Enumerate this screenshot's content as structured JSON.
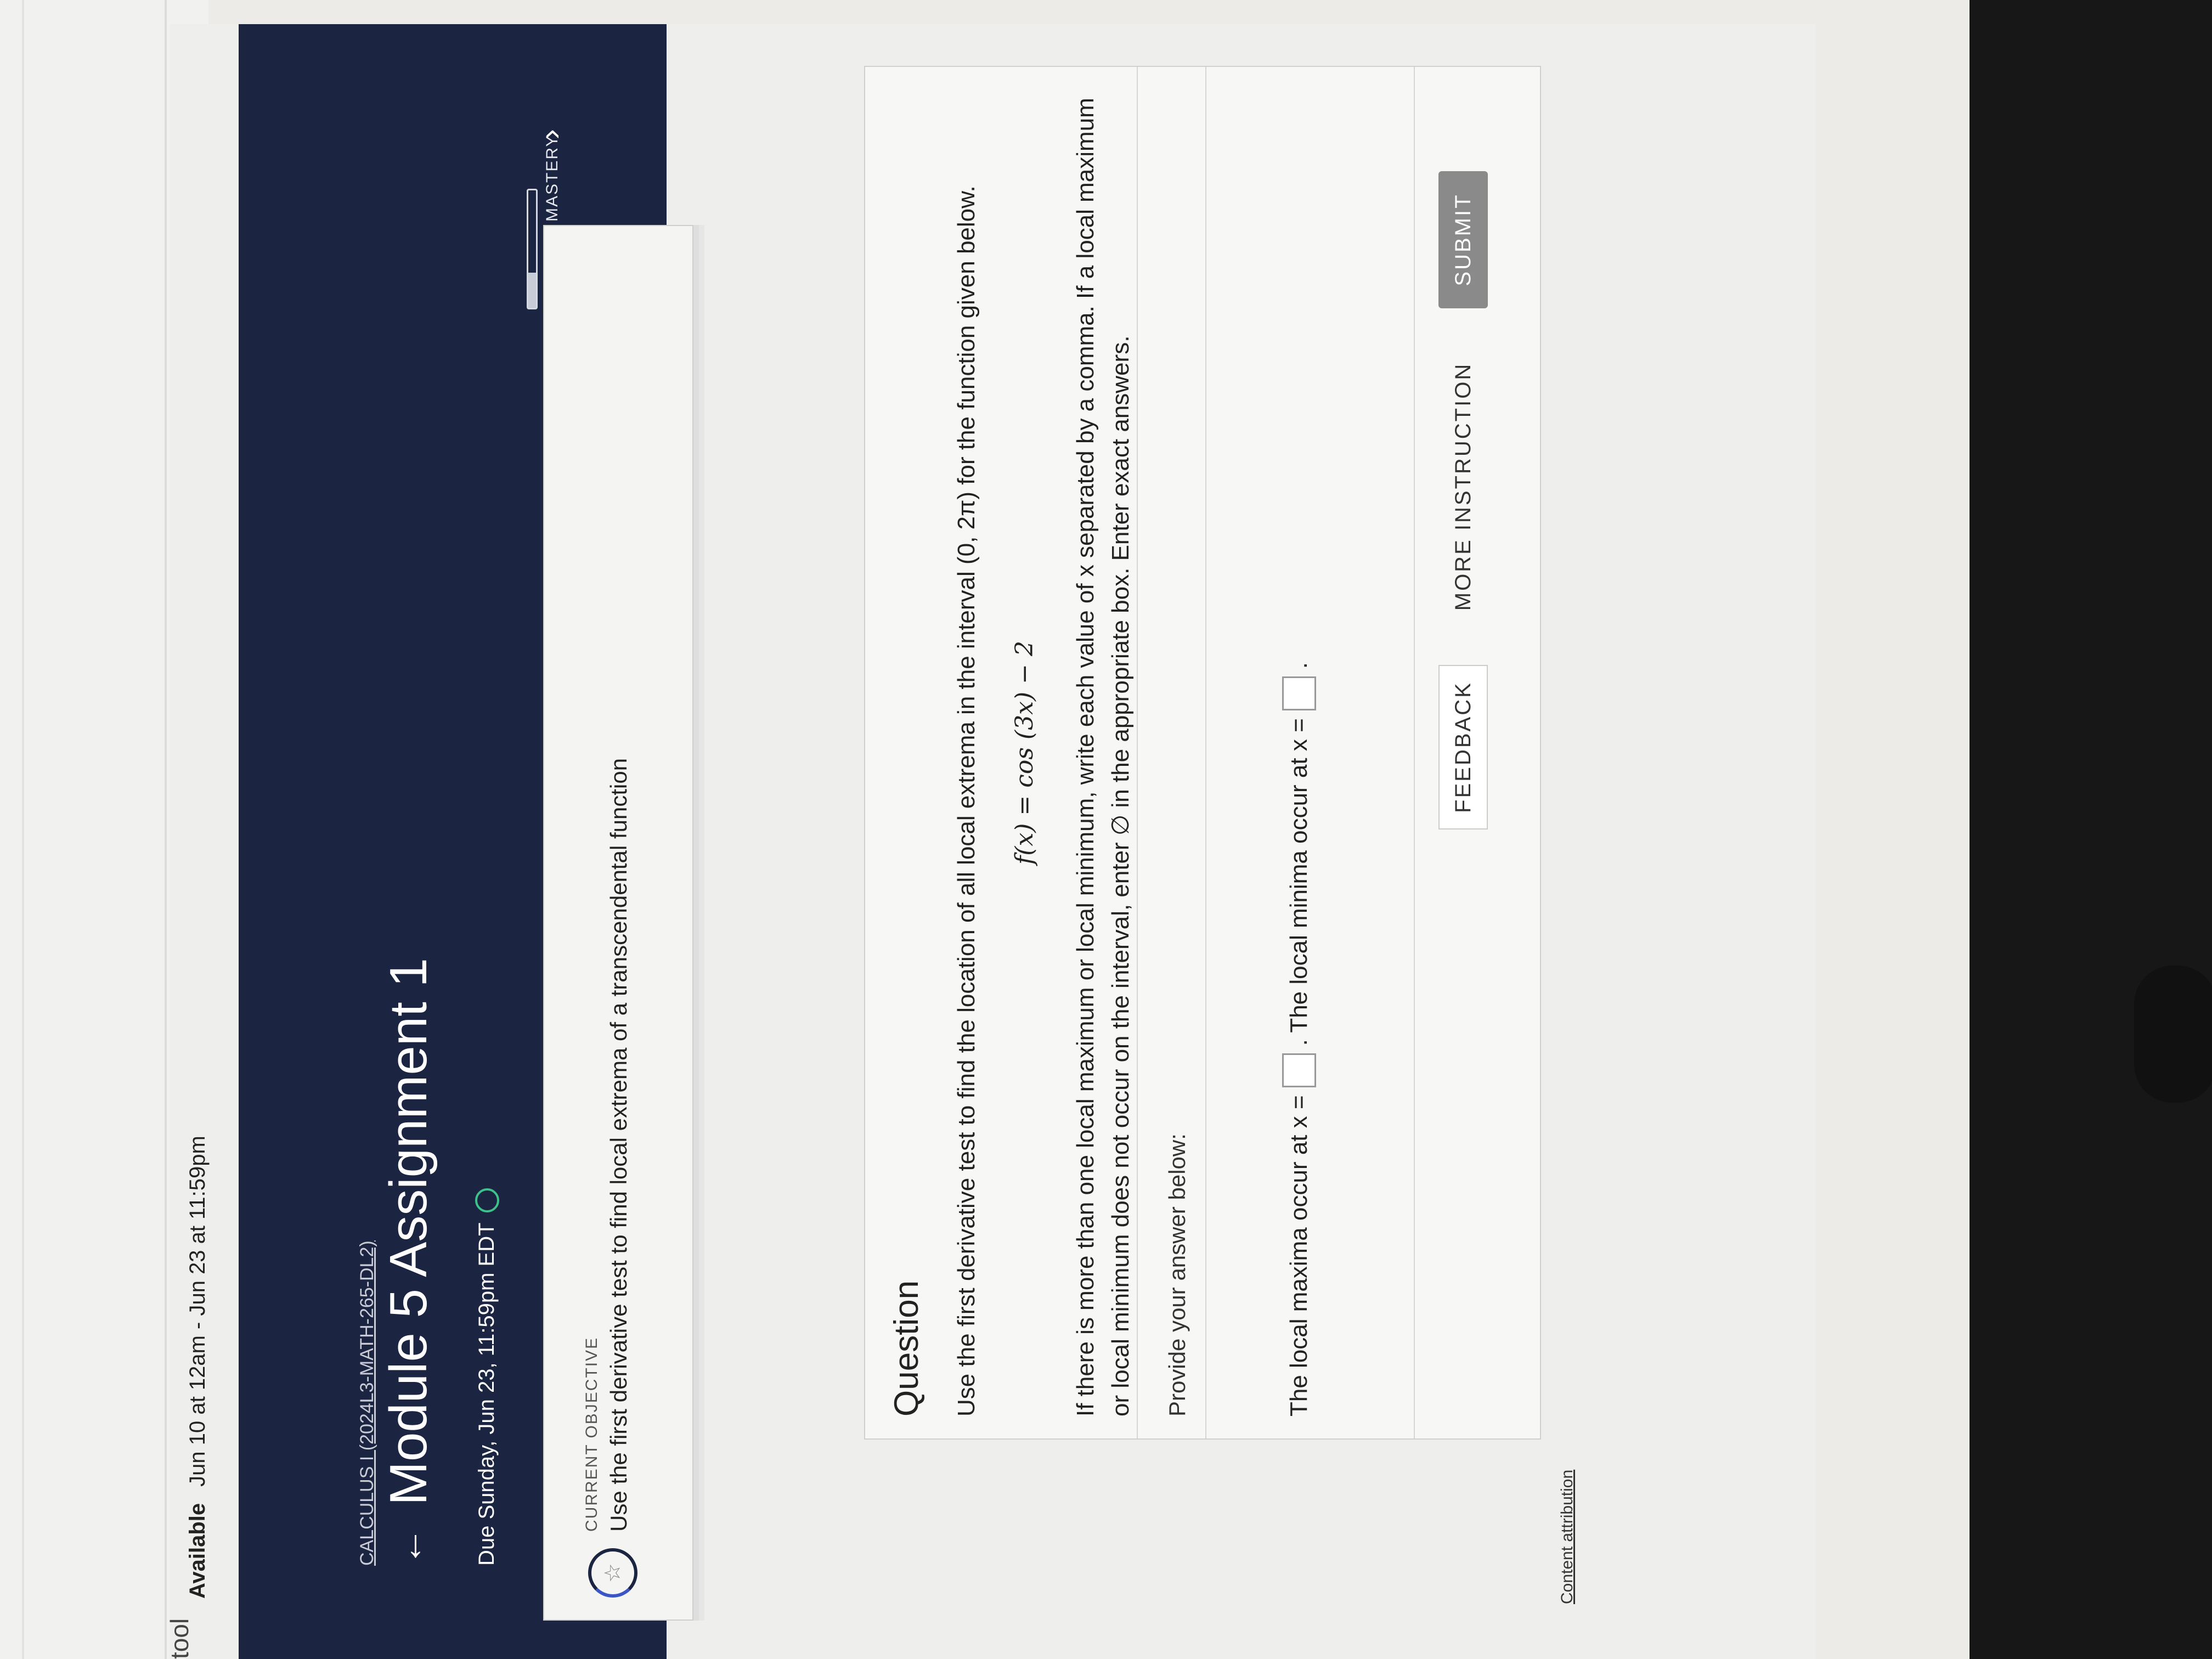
{
  "browser": {
    "tab_text": "tool"
  },
  "availability": {
    "label": "Available",
    "range": "Jun 10 at 12am - Jun 23 at 11:59pm"
  },
  "header": {
    "course": "CALCULUS I (2024L3-MATH-265-DL2)",
    "title": "Module 5 Assignment 1",
    "due": "Due Sunday, Jun 23, 11:59pm EDT",
    "mastery_label": "MASTERY",
    "mastery_progress": 0.3
  },
  "objective": {
    "caption": "CURRENT OBJECTIVE",
    "text": "Use the first derivative test to find local extrema of a transcendental function"
  },
  "question": {
    "heading": "Question",
    "prompt": "Use the first derivative test to find the location of all local extrema in the interval (0, 2π) for the function given below.",
    "equation": "f(x) = cos (3x) − 2",
    "instructions": "If there is more than one local maximum or local minimum, write each value of x separated by a comma. If a local maximum or local minimum does not occur on the interval, enter ∅ in the appropriate box. Enter exact answers.",
    "provide": "Provide your answer below:",
    "maxima_text": "The local maxima occur at x =",
    "minima_text": ". The local minima occur at x =",
    "end_text": "."
  },
  "buttons": {
    "feedback": "FEEDBACK",
    "more": "MORE INSTRUCTION",
    "submit": "SUBMIT"
  },
  "footer": {
    "attribution": "Content attribution"
  }
}
